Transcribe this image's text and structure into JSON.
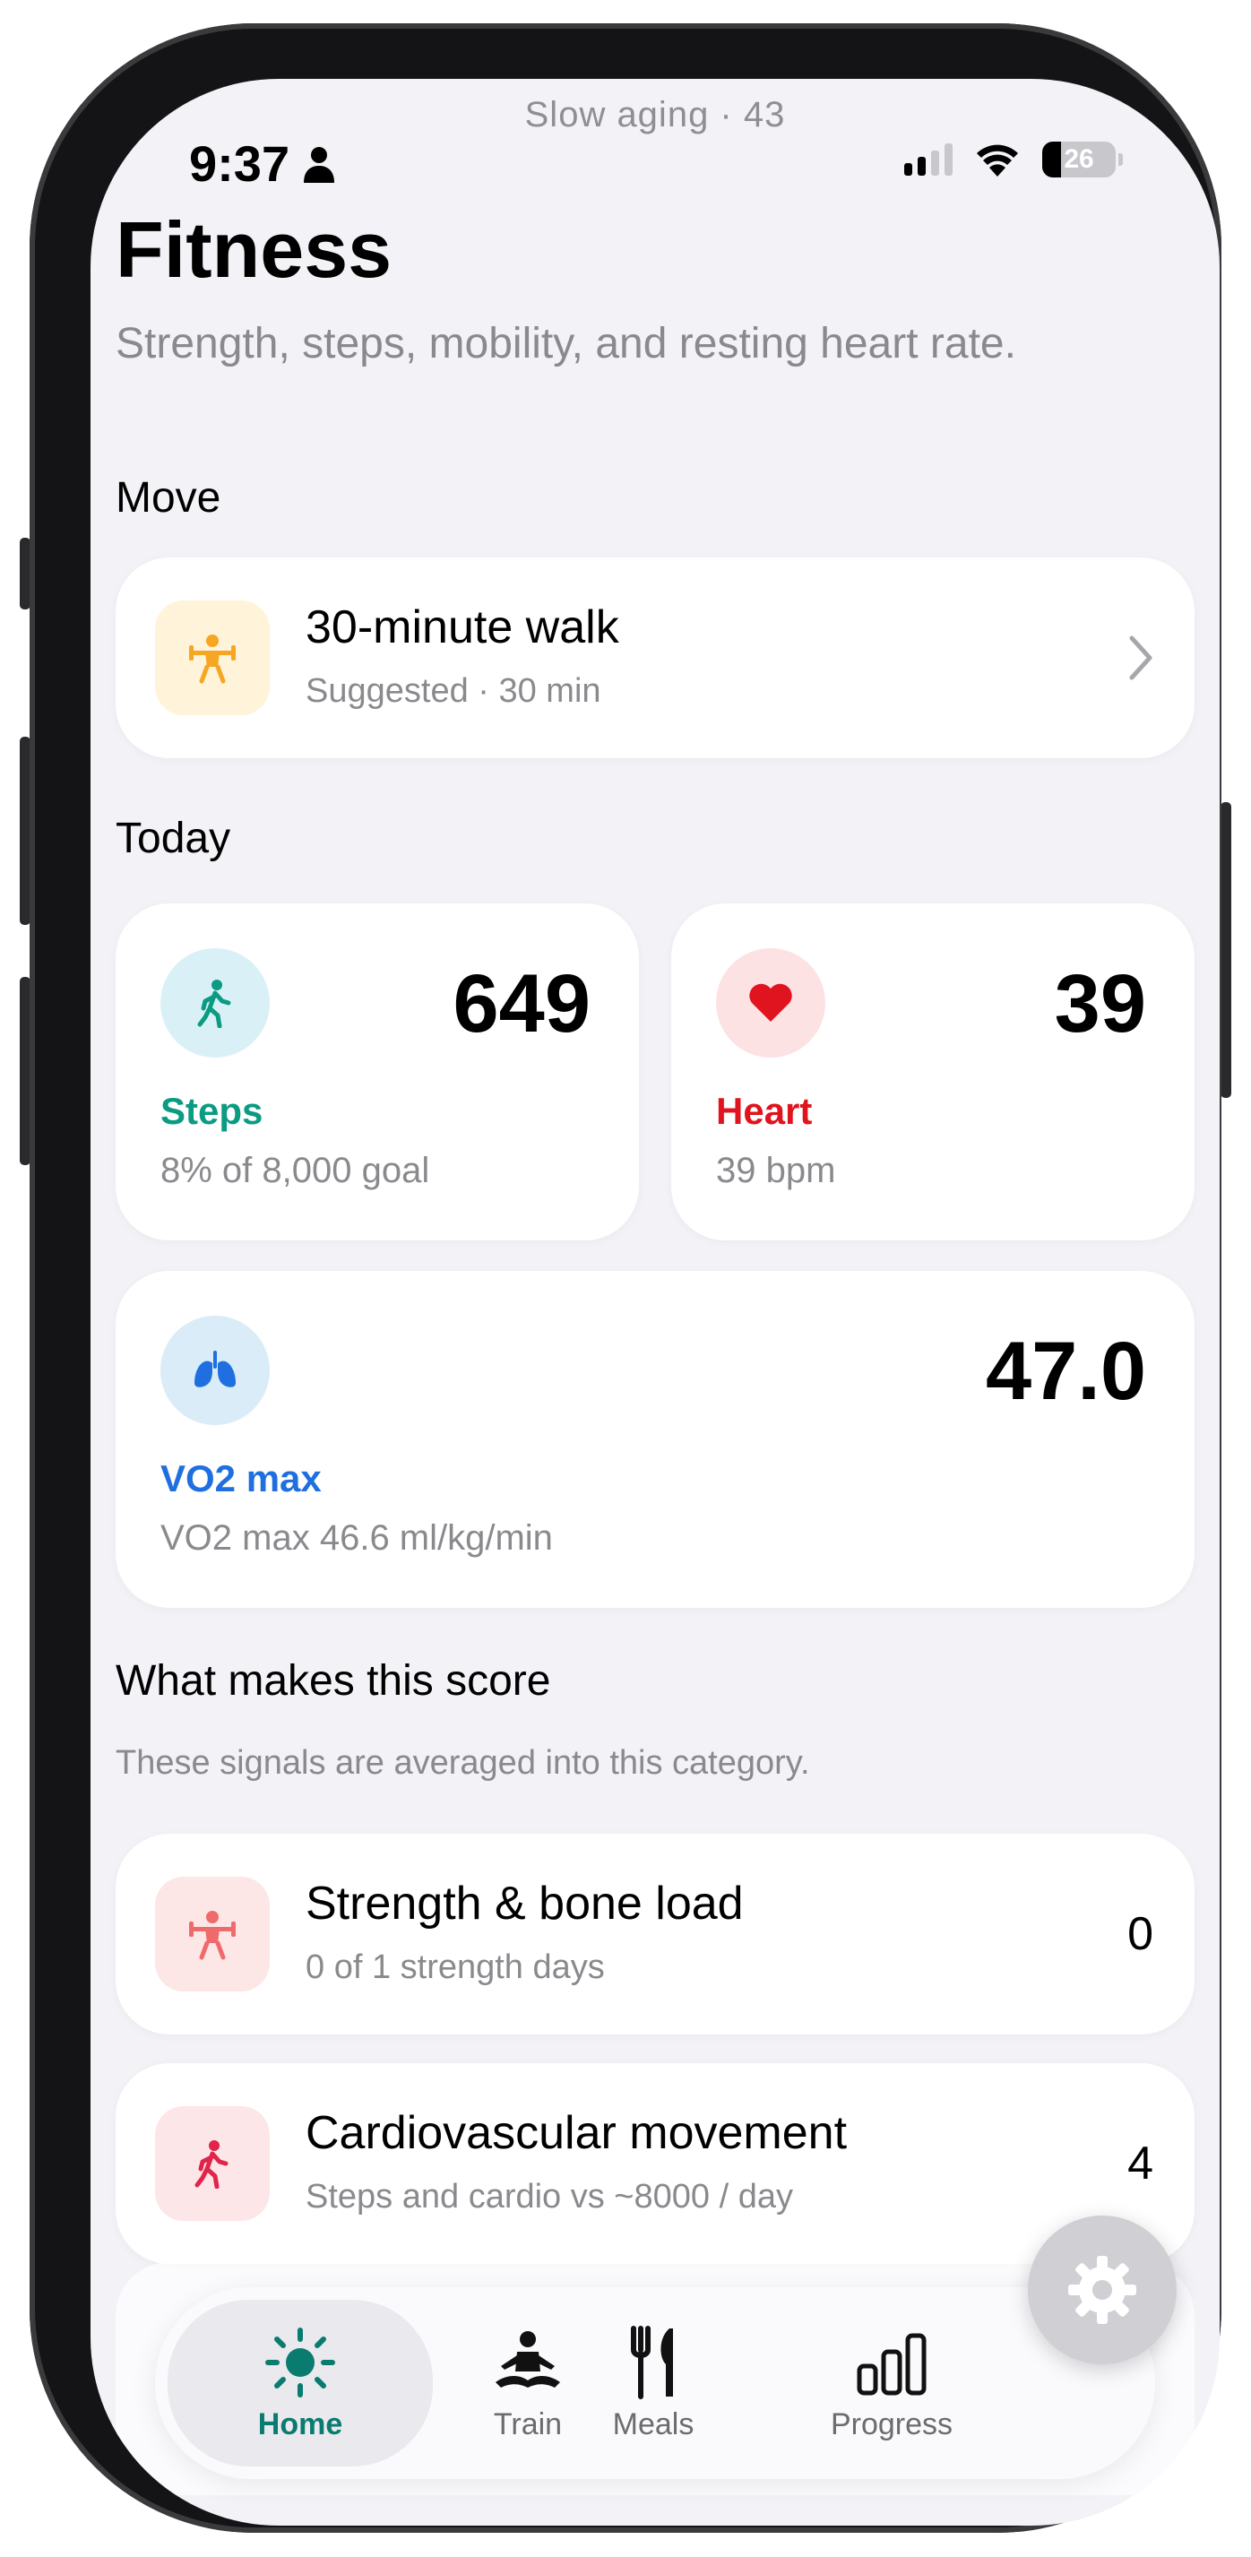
{
  "status_bar": {
    "banner": "Slow aging · 43",
    "time": "9:37",
    "battery": "26",
    "battery_level": 0.26
  },
  "header": {
    "title": "Fitness",
    "subtitle": "Strength, steps, mobility, and resting heart rate."
  },
  "move": {
    "section_title": "Move",
    "suggestion": {
      "title": "30-minute walk",
      "subtitle": "Suggested · 30 min",
      "icon": "strength-figure-icon"
    }
  },
  "today": {
    "section_title": "Today",
    "steps": {
      "value": "649",
      "label": "Steps",
      "sub": "8% of 8,000 goal",
      "color": "#0a9b82",
      "icon": "walking-icon"
    },
    "heart": {
      "value": "39",
      "label": "Heart",
      "sub": "39 bpm",
      "color": "#e0141e",
      "icon": "heart-icon"
    },
    "vo2": {
      "value": "47.0",
      "label": "VO2 max",
      "sub": "VO2 max 46.6 ml/kg/min",
      "color": "#1f6fe0",
      "icon": "lungs-icon"
    }
  },
  "score": {
    "section_title": "What makes this score",
    "caption": "These signals are averaged into this category.",
    "items": [
      {
        "title": "Strength & bone load",
        "subtitle": "0 of 1 strength days",
        "value": "0",
        "icon": "strength-figure-icon"
      },
      {
        "title": "Cardiovascular movement",
        "subtitle": "Steps and cardio vs ~8000 / day",
        "value": "4",
        "icon": "walking-icon"
      }
    ]
  },
  "tabs": [
    {
      "label": "Home",
      "icon": "sun-icon",
      "active": true
    },
    {
      "label": "Train",
      "icon": "meditation-icon",
      "active": false
    },
    {
      "label": "Meals",
      "icon": "fork-knife-icon",
      "active": false
    },
    {
      "label": "Progress",
      "icon": "bars-icon",
      "active": false
    }
  ],
  "colors": {
    "accent": "#0a7b6f",
    "background": "#f2f2f7",
    "card": "#ffffff",
    "secondary_text": "#8a8a8e"
  }
}
